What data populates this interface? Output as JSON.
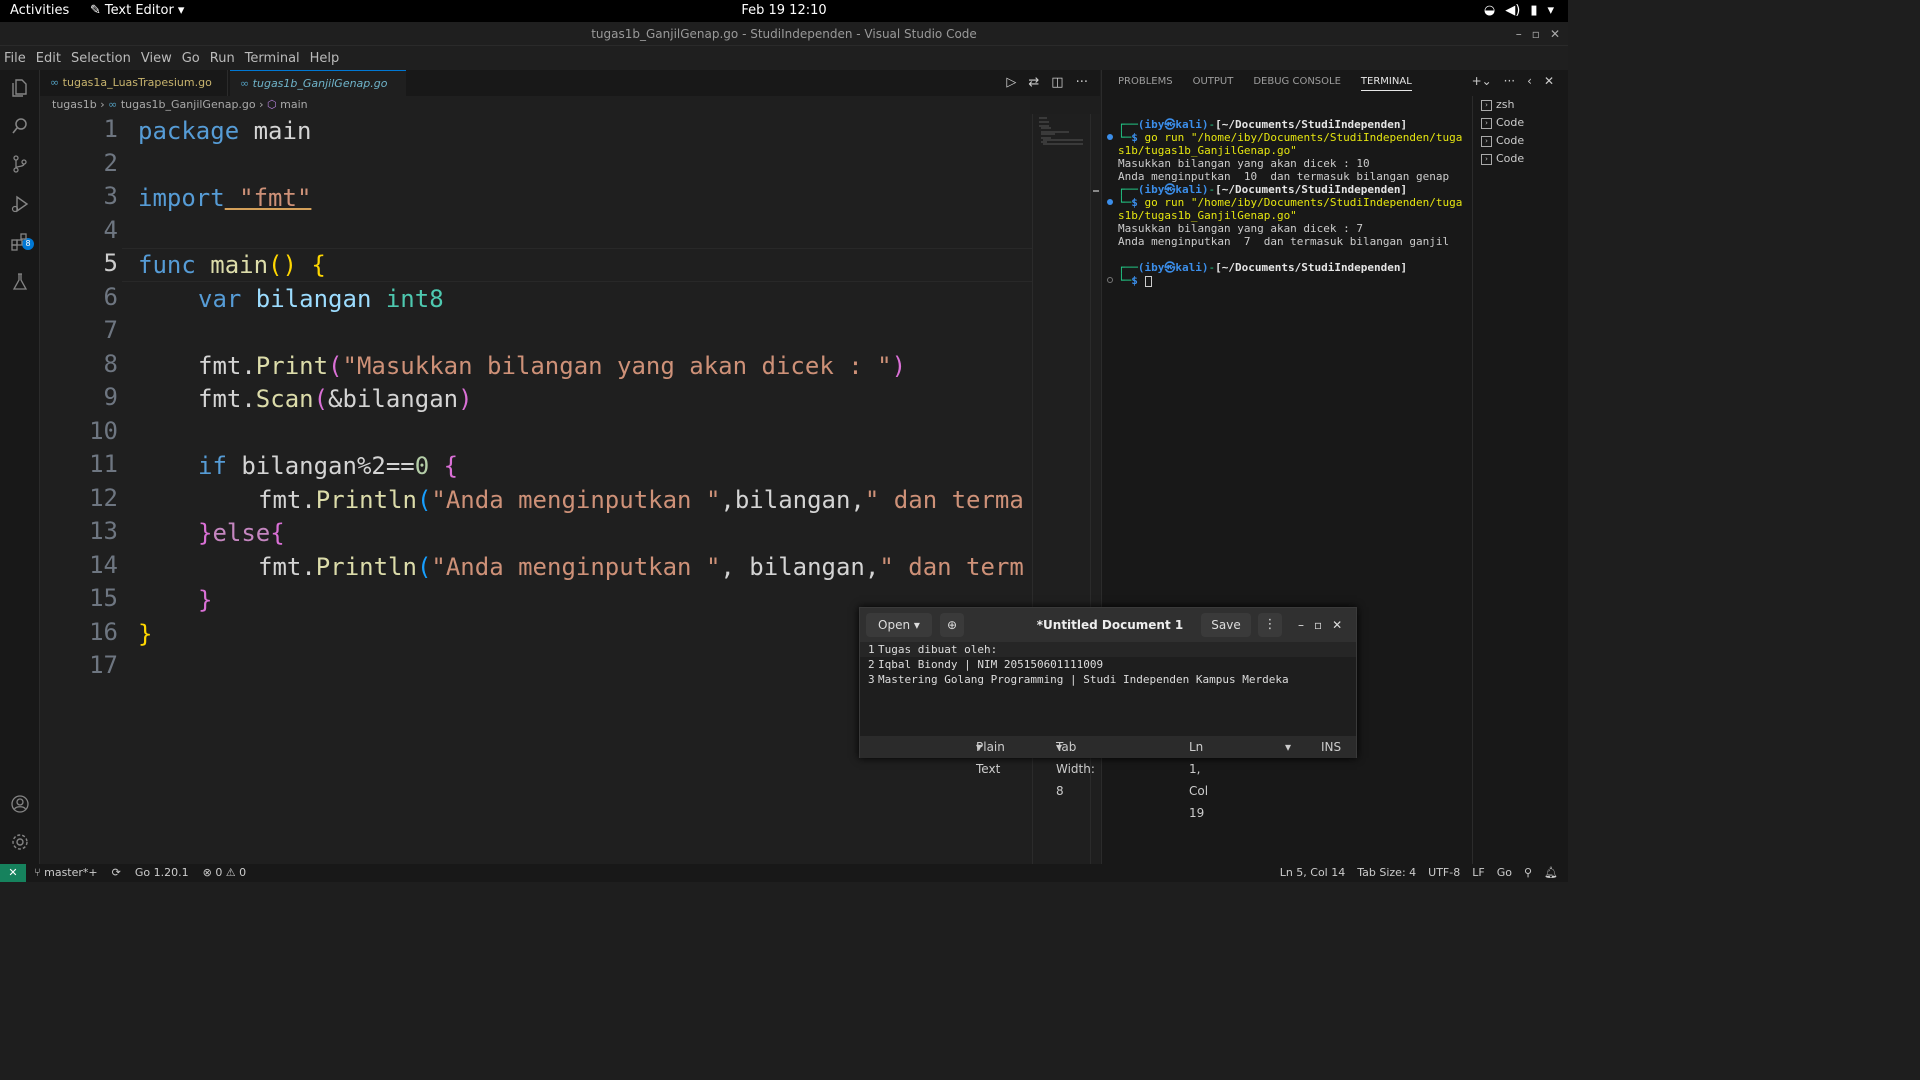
{
  "system_bar": {
    "activities": "Activities",
    "app_name": "Text Editor",
    "clock": "Feb 19  12:10"
  },
  "window": {
    "title": "tugas1b_GanjilGenap.go - StudiIndependen - Visual Studio Code"
  },
  "menu": [
    "File",
    "Edit",
    "Selection",
    "View",
    "Go",
    "Run",
    "Terminal",
    "Help"
  ],
  "activity_badge": "8",
  "tabs": [
    {
      "label": "tugas1a_LuasTrapesium.go",
      "status": "M"
    },
    {
      "label": "tugas1b_GanjilGenap.go",
      "status": "A"
    }
  ],
  "breadcrumb": {
    "folder": "tugas1b",
    "file": "tugas1b_GanjilGenap.go",
    "symbol": "main"
  },
  "editor": {
    "line_numbers": [
      "1",
      "2",
      "3",
      "4",
      "5",
      "6",
      "7",
      "8",
      "9",
      "10",
      "11",
      "12",
      "13",
      "14",
      "15",
      "16",
      "17"
    ],
    "current_line": "5",
    "code": {
      "l1_kw": "package",
      "l1_name": " main",
      "l3_kw": "import",
      "l3_str": " \"fmt\"",
      "l5_kw": "func",
      "l5_fn": " main",
      "l5_paren": "()",
      "l5_brace": " {",
      "l6_kw": "var",
      "l6_var": " bilangan",
      "l6_ty": " int8",
      "l8_pkg": "fmt.",
      "l8_fn": "Print",
      "l8_p1": "(",
      "l8_str": "\"Masukkan bilangan yang akan dicek : \"",
      "l8_p2": ")",
      "l9_pkg": "fmt.",
      "l9_fn": "Scan",
      "l9_p1": "(",
      "l9_arg": "&bilangan",
      "l9_p2": ")",
      "l11_kw": "if",
      "l11_cond": " bilangan%2==",
      "l11_num": "0",
      "l11_brace": " {",
      "l12_pkg": "fmt.",
      "l12_fn": "Println",
      "l12_p": "(",
      "l12_str": "\"Anda menginputkan \"",
      "l12_rest": ",bilangan,",
      "l12_str2": "\" dan terma",
      "l13_b1": "}",
      "l13_kw": "else",
      "l13_b2": "{",
      "l14_pkg": "fmt.",
      "l14_fn": "Println",
      "l14_p": "(",
      "l14_str": "\"Anda menginputkan \"",
      "l14_rest": ", bilangan,",
      "l14_str2": "\" dan term",
      "l15_brace": "}",
      "l16_brace": "}"
    }
  },
  "panel": {
    "tabs": [
      "PROBLEMS",
      "OUTPUT",
      "DEBUG CONSOLE",
      "TERMINAL"
    ],
    "active_tab": "TERMINAL",
    "terminal_list": [
      "zsh",
      "Code",
      "Code",
      "Code"
    ],
    "terminal": {
      "p1_user": "(iby㉿kali)",
      "p1_path": "[~/Documents/StudiIndependen]",
      "cmd1_a": "go run \"/home/iby/Documents/StudiIndependen/tuga",
      "cmd1_b": "s1b/tugas1b_GanjilGenap.go\"",
      "out1_a": "Masukkan bilangan yang akan dicek : 10",
      "out1_b": "Anda menginputkan  10  dan termasuk bilangan genap",
      "p2_user": "(iby㉿kali)",
      "p2_path": "[~/Documents/StudiIndependen]",
      "cmd2_a": "go run \"/home/iby/Documents/StudiIndependen/tuga",
      "cmd2_b": "s1b/tugas1b_GanjilGenap.go\"",
      "out2_a": "Masukkan bilangan yang akan dicek : 7",
      "out2_b": "Anda menginputkan  7  dan termasuk bilangan ganjil",
      "p3_user": "(iby㉿kali)",
      "p3_path": "[~/Documents/StudiIndependen]",
      "prompt_char": "$"
    }
  },
  "status_bar": {
    "branch": "master*+",
    "go_version": "Go 1.20.1",
    "problems": "0 ⚠ 0",
    "position": "Ln 5, Col 14",
    "tab_size": "Tab Size: 4",
    "encoding": "UTF-8",
    "eol": "LF",
    "language": "Go"
  },
  "text_editor": {
    "open_label": "Open",
    "title": "*Untitled Document 1",
    "save_label": "Save",
    "lines": [
      {
        "num": "1",
        "text": "Tugas dibuat oleh:"
      },
      {
        "num": "2",
        "text": "Iqbal Biondy | NIM 205150601111009"
      },
      {
        "num": "3",
        "text": "Mastering Golang Programming | Studi Independen Kampus Merdeka"
      }
    ],
    "language": "Plain Text",
    "tab_width": "Tab Width: 8",
    "cursor_pos": "Ln 1, Col 19",
    "mode": "INS"
  }
}
